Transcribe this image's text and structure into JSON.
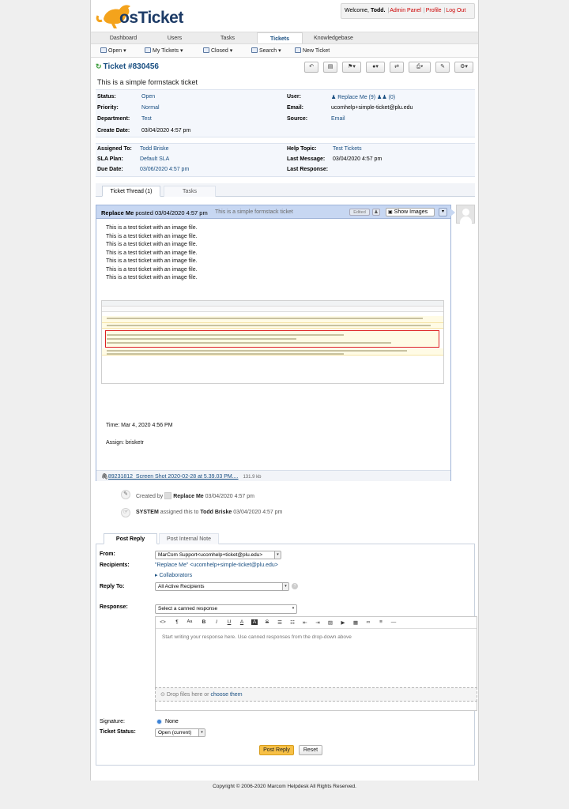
{
  "header": {
    "logo_text": "osTicket",
    "welcome_prefix": "Welcome, ",
    "user_name": "Todd.",
    "links": {
      "admin": "Admin Panel",
      "profile": "Profile",
      "logout": "Log Out"
    }
  },
  "nav": {
    "tabs": [
      "Dashboard",
      "Users",
      "Tasks",
      "Tickets",
      "Knowledgebase"
    ],
    "active": "Tickets"
  },
  "subnav": {
    "open": "Open ▾",
    "my_tickets": "My Tickets ▾",
    "closed": "Closed ▾",
    "search": "Search ▾",
    "new_ticket": "New Ticket"
  },
  "ticket": {
    "number": "Ticket #830456",
    "subject": "This is a simple formstack ticket",
    "toolbar_icons": [
      "reply-icon",
      "print-icon",
      "flag-icon",
      "assign-icon",
      "transfer-icon",
      "print-menu-icon",
      "edit-icon",
      "settings-icon"
    ]
  },
  "info": {
    "status_label": "Status:",
    "status": "Open",
    "priority_label": "Priority:",
    "priority": "Normal",
    "department_label": "Department:",
    "department": "Test",
    "create_label": "Create Date:",
    "create_date": "03/04/2020 4:57 pm",
    "user_label": "User:",
    "user": "Replace Me (9)",
    "user_count": "(0)",
    "email_label": "Email:",
    "email": "ucomhelp+simple-ticket@plu.edu",
    "source_label": "Source:",
    "source": "Email",
    "assigned_label": "Assigned To:",
    "assigned": "Todd Briske",
    "sla_label": "SLA Plan:",
    "sla": "Default SLA",
    "due_label": "Due Date:",
    "due": "03/06/2020 4:57 pm",
    "topic_label": "Help Topic:",
    "topic": "Test Tickets",
    "lastmsg_label": "Last Message:",
    "lastmsg": "03/04/2020 4:57 pm",
    "lastresp_label": "Last Response:",
    "lastresp": ""
  },
  "thread_tabs": {
    "thread": "Ticket Thread (1)",
    "tasks": "Tasks"
  },
  "entry": {
    "poster": "Replace Me",
    "posted": " posted 03/04/2020 4:57 pm",
    "subject": "This is a simple formstack ticket",
    "edited": "Edited",
    "show_images": "Show Images",
    "body_lines": [
      "This is a test ticket with an image file.",
      "This is a test ticket with an image file.",
      "This is a test ticket with an image file.",
      "This is a test ticket with an image file.",
      "This is a test ticket with an image file.",
      "This is a test ticket with an image file.",
      "This is a test ticket with an image file."
    ],
    "time": "Time: Mar 4, 2020 4:56 PM",
    "assign": "Assign: brisketr",
    "attachment": "89231812_Screen Shot 2020-02-28 at 5.39.03 PM....",
    "attachment_size": "131.9 kb"
  },
  "events": {
    "created_prefix": "Created by ",
    "created_by": "Replace Me",
    "created_time": " 03/04/2020 4:57 pm",
    "system": "SYSTEM",
    "assigned_text": " assigned this to ",
    "assignee": "Todd Briske",
    "assigned_time": " 03/04/2020 4:57 pm"
  },
  "reply": {
    "tabs": [
      "Post Reply",
      "Post Internal Note"
    ],
    "from_label": "From:",
    "from": "MarCom Support<ucomhelp+ticket@plu.edu>",
    "recipients_label": "Recipients:",
    "recipients": "\"Replace Me\" <ucomhelp+simple-ticket@plu.edu>",
    "collaborators": "▸ Collaborators",
    "replyto_label": "Reply To:",
    "replyto": "All Active Recipients",
    "response_label": "Response:",
    "canned": "Select a canned response",
    "editor_placeholder": "Start writing your response here. Use canned responses from the drop-down above",
    "drop_text": "Drop files here or ",
    "drop_link": "choose them",
    "signature_label": "Signature:",
    "signature": "None",
    "status_label": "Ticket Status:",
    "status": "Open (current)",
    "post": "Post Reply",
    "reset": "Reset"
  },
  "footer": "Copyright © 2006-2020 Marcom Helpdesk All Rights Reserved.",
  "colors": {
    "link": "#184e81",
    "logout": "#c00",
    "accent_button": "#f7c046",
    "header_blue": "#c7d7f2"
  }
}
